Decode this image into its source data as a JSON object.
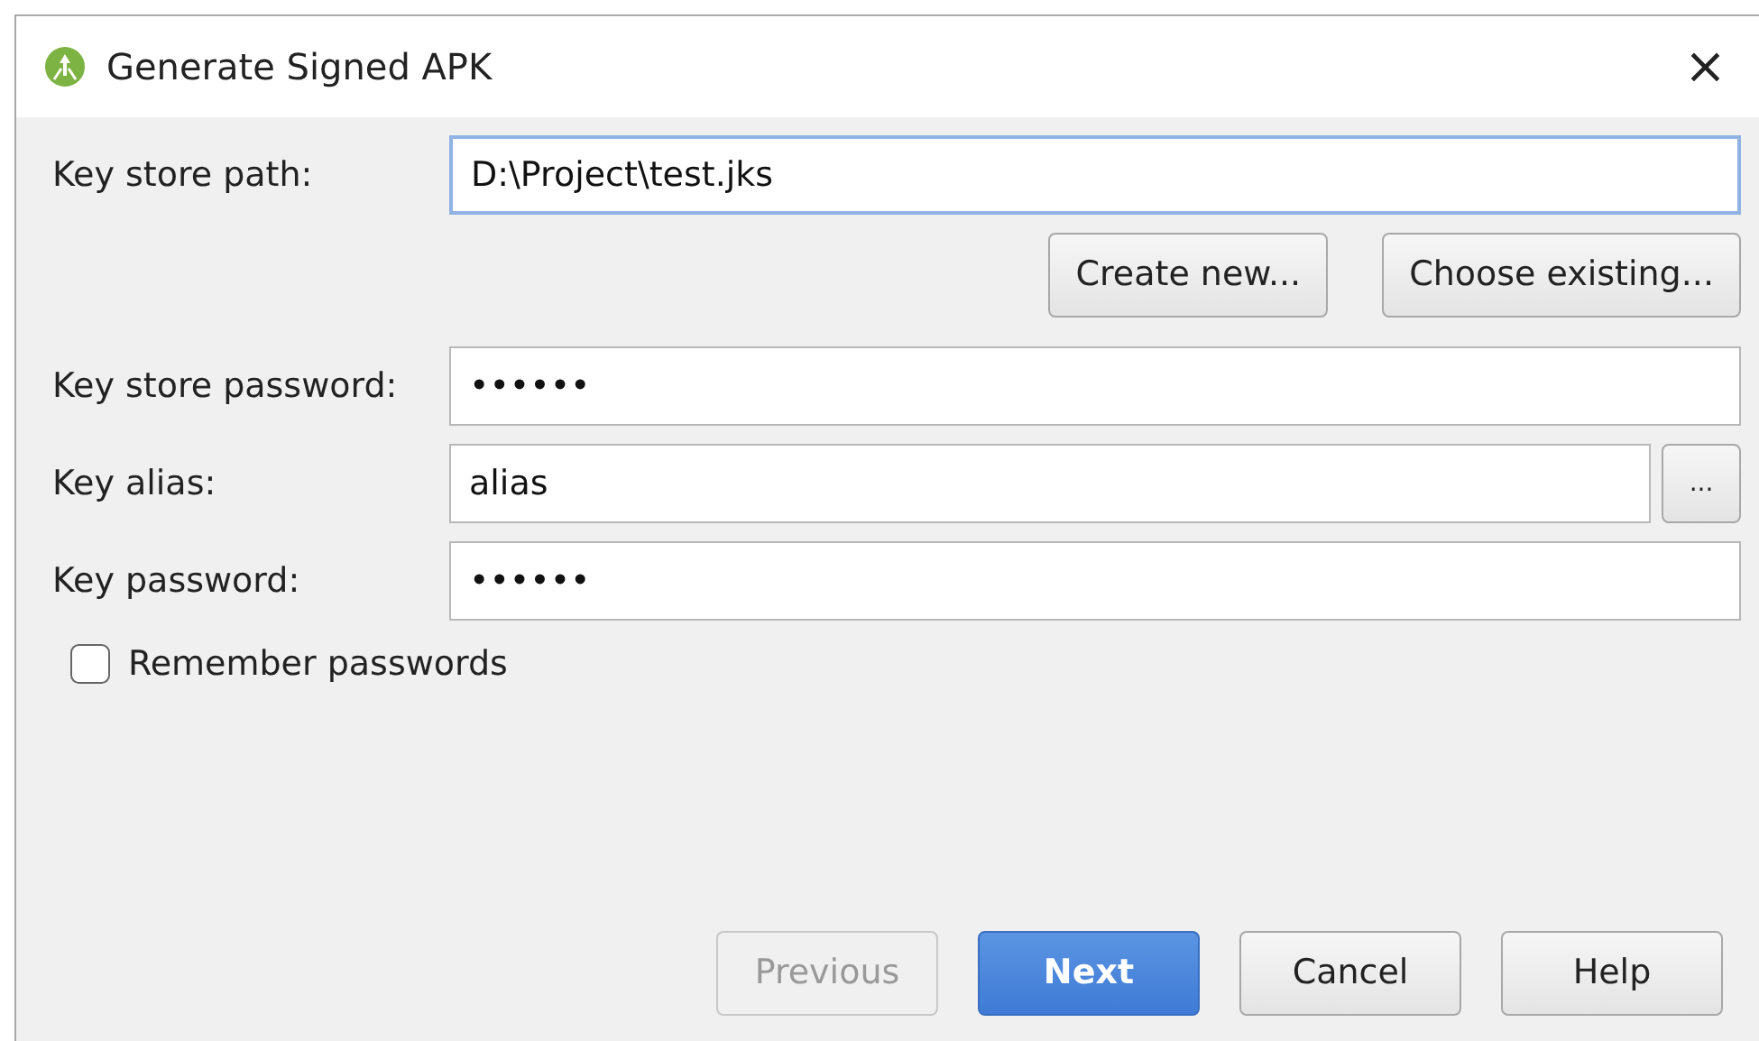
{
  "window": {
    "title": "Generate Signed APK",
    "close": "×"
  },
  "fields": [
    {
      "label": "Key store path:",
      "value": "D:\\Project\\test.jks",
      "focused": true
    },
    {
      "kind": "buttons",
      "buttons": [
        "Create new...",
        "Choose existing..."
      ]
    },
    {
      "label": "Key store password:",
      "value": "••••••",
      "focused": false
    },
    {
      "label": "Key alias:",
      "value": "alias",
      "focused": false,
      "browse": "..."
    },
    {
      "label": "Key password:",
      "value": "••••••",
      "focused": false
    }
  ],
  "remember": {
    "label": "Remember passwords",
    "checked": false
  },
  "buttons": [
    {
      "label": "Previous",
      "disabled": true,
      "default": false
    },
    {
      "label": "Next",
      "disabled": false,
      "default": true
    },
    {
      "label": "Cancel",
      "disabled": false,
      "default": false
    },
    {
      "label": "Help",
      "disabled": false,
      "default": false
    }
  ]
}
